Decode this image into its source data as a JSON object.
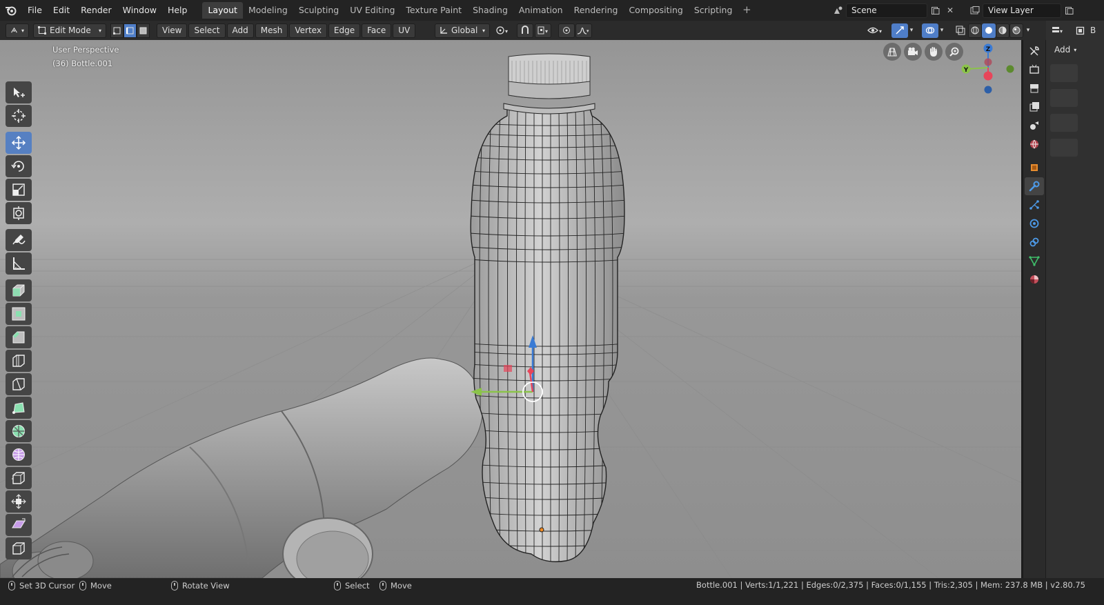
{
  "menubar": {
    "items": [
      "File",
      "Edit",
      "Render",
      "Window",
      "Help"
    ]
  },
  "workspaces": {
    "tabs": [
      "Layout",
      "Modeling",
      "Sculpting",
      "UV Editing",
      "Texture Paint",
      "Shading",
      "Animation",
      "Rendering",
      "Compositing",
      "Scripting"
    ],
    "active": "Layout",
    "add_label": "+"
  },
  "scene": {
    "name": "Scene"
  },
  "view_layer": {
    "name": "View Layer"
  },
  "header": {
    "mode": "Edit Mode",
    "menus": [
      "View",
      "Select",
      "Add",
      "Mesh",
      "Vertex",
      "Edge",
      "Face",
      "UV"
    ],
    "transform_orientation": "Global"
  },
  "viewport": {
    "perspective_label": "User Perspective",
    "object_label": "(36) Bottle.001",
    "gizmo_axes": {
      "z": "Z",
      "y": "Y"
    }
  },
  "properties": {
    "add_label": "Add",
    "cut_label": "B"
  },
  "statusbar": {
    "left": [
      {
        "label": "Set 3D Cursor"
      },
      {
        "label": "Move"
      },
      {
        "label": "Rotate View"
      },
      {
        "label": "Select"
      },
      {
        "label": "Move"
      }
    ],
    "stats": "Bottle.001 | Verts:1/1,221 | Edges:0/2,375 | Faces:0/1,155 | Tris:2,305 | Mem: 237.8 MB | v2.80.75"
  },
  "colors": {
    "accent": "#4f7ec8",
    "axis_x": "#e8455a",
    "axis_y": "#8bc34a",
    "axis_z": "#3a7bd5"
  }
}
